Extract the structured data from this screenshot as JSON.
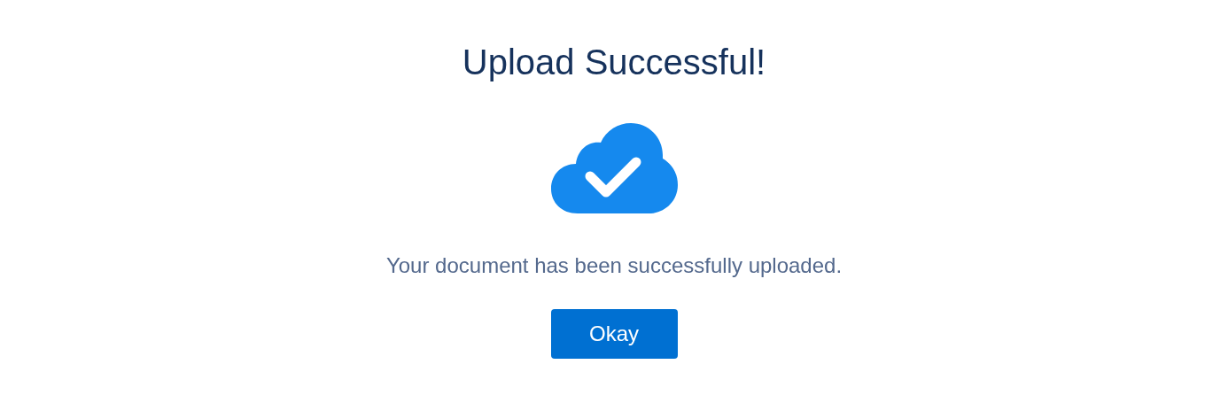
{
  "dialog": {
    "title": "Upload Successful!",
    "message": "Your document has been successfully uploaded.",
    "buttons": [
      "Okay"
    ]
  }
}
